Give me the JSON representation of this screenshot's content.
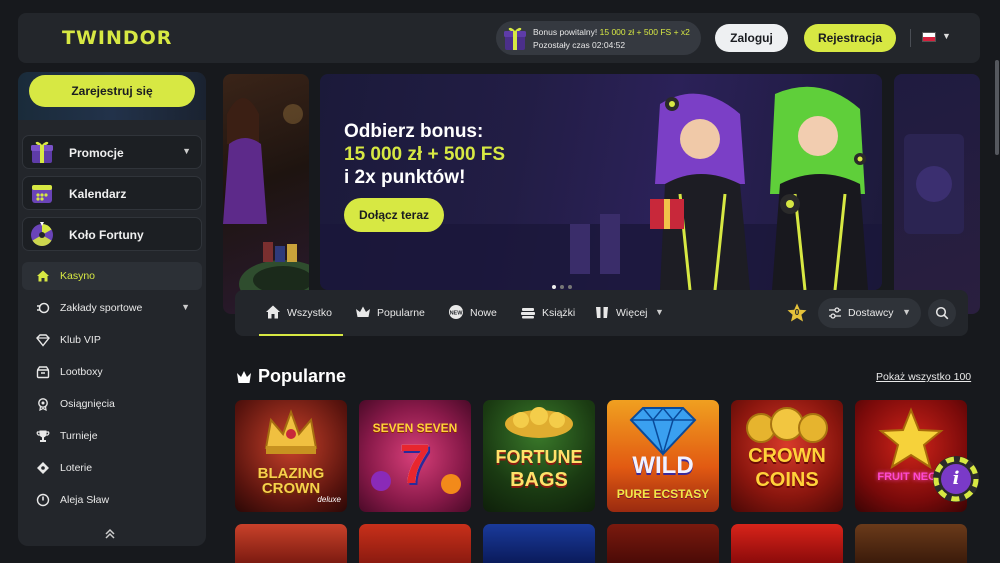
{
  "header": {
    "logo": "TWINDOR",
    "bonus": {
      "prefix": "Bonus powitalny!",
      "highlight": "15 000 zł + 500 FS + x2",
      "timer_label": "Pozostały czas 02:04:52"
    },
    "login_label": "Zaloguj",
    "register_label": "Rejestracja",
    "language": "pl",
    "colors": {
      "accent": "#d7e843",
      "bg": "#17191d",
      "panel": "#23262b"
    }
  },
  "sidebar": {
    "signup_label": "Zarejestruj się",
    "promo_items": [
      {
        "label": "Promocje",
        "icon": "gift-box-icon"
      },
      {
        "label": "Kalendarz",
        "icon": "calendar-icon"
      },
      {
        "label": "Koło Fortuny",
        "icon": "wheel-of-fortune-icon"
      }
    ],
    "nav_items": [
      {
        "label": "Kasyno",
        "icon": "home-icon",
        "active": true
      },
      {
        "label": "Zakłady sportowe",
        "icon": "sports-ball-icon"
      },
      {
        "label": "Klub VIP",
        "icon": "diamond-icon"
      },
      {
        "label": "Lootboxy",
        "icon": "lootbox-icon"
      },
      {
        "label": "Osiągnięcia",
        "icon": "medal-icon"
      },
      {
        "label": "Turnieje",
        "icon": "trophy-icon"
      },
      {
        "label": "Loterie",
        "icon": "lottery-icon"
      },
      {
        "label": "Aleja Sław",
        "icon": "fame-icon"
      }
    ]
  },
  "banner": {
    "line1": "Odbierz bonus:",
    "line2": "15 000 zł + 500 FS",
    "line3": "i 2x punktów!",
    "cta_label": "Dołącz teraz"
  },
  "categories": {
    "tabs": [
      {
        "label": "Wszystko",
        "icon": "home-icon",
        "active": true
      },
      {
        "label": "Popularne",
        "icon": "crown-icon"
      },
      {
        "label": "Nowe",
        "icon": "new-badge-icon"
      },
      {
        "label": "Książki",
        "icon": "books-icon"
      },
      {
        "label": "Więcej",
        "icon": "more-icon"
      }
    ],
    "fav_count": "0",
    "providers_label": "Dostawcy"
  },
  "section": {
    "title": "Popularne",
    "show_all": "Pokaż wszystko 100"
  },
  "games": [
    {
      "name": "BLAZING CROWN",
      "sub": "deluxe"
    },
    {
      "name": "SEVEN SEVEN",
      "sub": "7"
    },
    {
      "name": "FORTUNE",
      "sub": "BAGS"
    },
    {
      "name": "WILD",
      "sub": "PURE ECSTASY"
    },
    {
      "name": "CROWN",
      "sub": "COINS"
    },
    {
      "name": "FRUIT NEON",
      "sub": ""
    }
  ],
  "info_label": "i"
}
